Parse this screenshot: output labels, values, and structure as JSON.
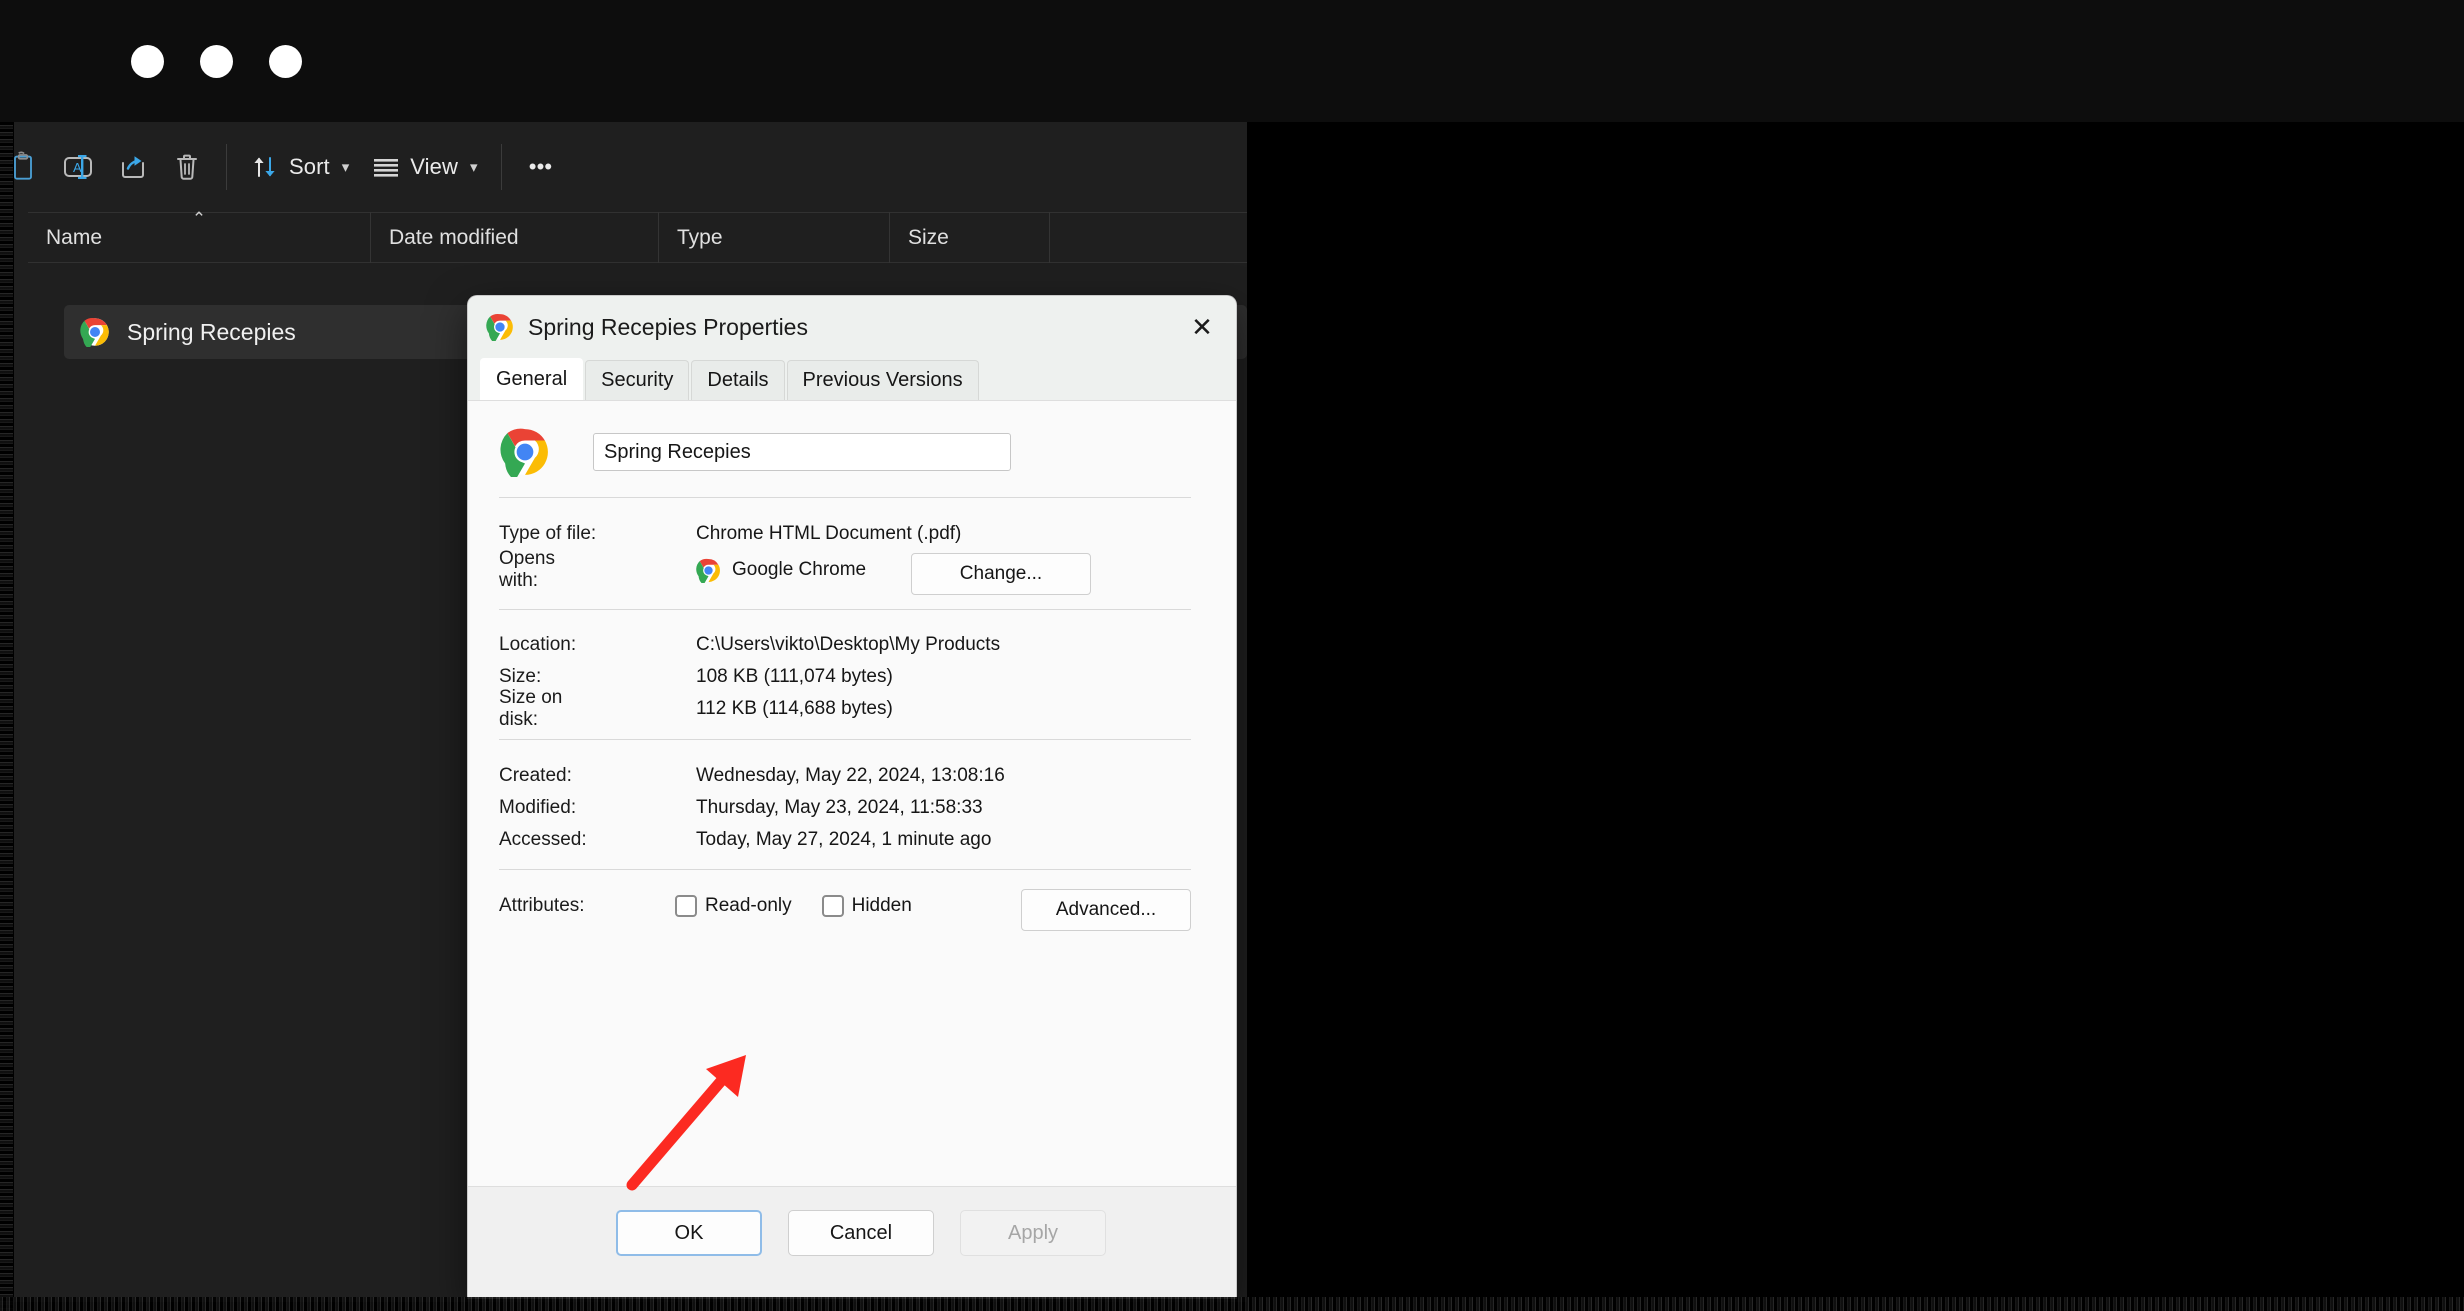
{
  "window_controls": {
    "buttons": [
      "recording-dot-1",
      "recording-dot-2",
      "recording-dot-3"
    ]
  },
  "explorer": {
    "toolbar": {
      "items": [
        {
          "name": "paste-button",
          "icon": "clipboard-paste-icon",
          "label": ""
        },
        {
          "name": "rename-button",
          "icon": "rename-icon",
          "label": ""
        },
        {
          "name": "share-button",
          "icon": "share-icon",
          "label": ""
        },
        {
          "name": "delete-button",
          "icon": "trash-icon",
          "label": ""
        },
        {
          "name": "sort-button",
          "icon": "sort-arrows-icon",
          "label": "Sort"
        },
        {
          "name": "view-button",
          "icon": "view-lines-icon",
          "label": "View"
        },
        {
          "name": "more-button",
          "icon": "ellipsis-icon",
          "label": ""
        }
      ],
      "sort_label": "Sort",
      "view_label": "View",
      "more_label": "•••"
    },
    "columns": [
      {
        "label": "Name",
        "sorted": true,
        "sort_mark": "⌃"
      },
      {
        "label": "Date modified"
      },
      {
        "label": "Type"
      },
      {
        "label": "Size"
      }
    ],
    "files": [
      {
        "name": "Spring Recepies",
        "icon": "chrome-icon",
        "selected": true
      }
    ]
  },
  "dialog": {
    "title": "Spring Recepies Properties",
    "title_icon": "chrome-icon",
    "close_label": "✕",
    "tabs": [
      {
        "label": "General",
        "active": true
      },
      {
        "label": "Security",
        "active": false
      },
      {
        "label": "Details",
        "active": false
      },
      {
        "label": "Previous Versions",
        "active": false
      }
    ],
    "file_name_value": "Spring Recepies",
    "properties": [
      {
        "label": "Type of file:",
        "value": "Chrome HTML Document (.pdf)"
      },
      {
        "label": "Opens with:",
        "value": "Google Chrome"
      },
      {
        "label": "Location:",
        "value": "C:\\Users\\vikto\\Desktop\\My Products"
      },
      {
        "label": "Size:",
        "value": "108 KB (111,074 bytes)"
      },
      {
        "label": "Size on disk:",
        "value": "112 KB (114,688 bytes)"
      },
      {
        "label": "Created:",
        "value": "Wednesday, May 22, 2024, 13:08:16"
      },
      {
        "label": "Modified:",
        "value": "Thursday, May 23, 2024, 11:58:33"
      },
      {
        "label": "Accessed:",
        "value": "Today, May 27, 2024, 1 minute ago"
      },
      {
        "label": "Attributes:",
        "value": ""
      }
    ],
    "labels": {
      "type_of_file": "Type of file:",
      "opens_with": "Opens with:",
      "location": "Location:",
      "size": "Size:",
      "size_on_disk": "Size on disk:",
      "created": "Created:",
      "modified": "Modified:",
      "accessed": "Accessed:",
      "attributes": "Attributes:"
    },
    "values": {
      "type_of_file": "Chrome HTML Document (.pdf)",
      "opens_with": "Google Chrome",
      "location": "C:\\Users\\vikto\\Desktop\\My Products",
      "size": "108 KB (111,074 bytes)",
      "size_on_disk": "112 KB (114,688 bytes)",
      "created": "Wednesday, May 22, 2024, 13:08:16",
      "modified": "Thursday, May 23, 2024, 11:58:33",
      "accessed": "Today, May 27, 2024, 1 minute ago"
    },
    "change_button": "Change...",
    "advanced_button": "Advanced...",
    "checkboxes": [
      {
        "label": "Read-only",
        "checked": false
      },
      {
        "label": "Hidden",
        "checked": false
      }
    ],
    "readonly_label": "Read-only",
    "hidden_label": "Hidden",
    "footer": {
      "ok": "OK",
      "cancel": "Cancel",
      "apply": "Apply",
      "apply_disabled": true,
      "ok_focused": true
    }
  },
  "annotation": {
    "arrow": {
      "color": "#fc2a21",
      "points_to": "read-only-checkbox",
      "direction": "up-right"
    }
  },
  "colors": {
    "desktop_background": "#000000",
    "explorer_background": "#1f1f1f",
    "explorer_selection": "#2f2f2f",
    "dialog_background": "#fafafa",
    "dialog_titlebar": "#eef1ef",
    "accent_blue": "#3ba7e8",
    "focus_border": "#8fbce8",
    "annotation_red": "#fc2a21"
  }
}
